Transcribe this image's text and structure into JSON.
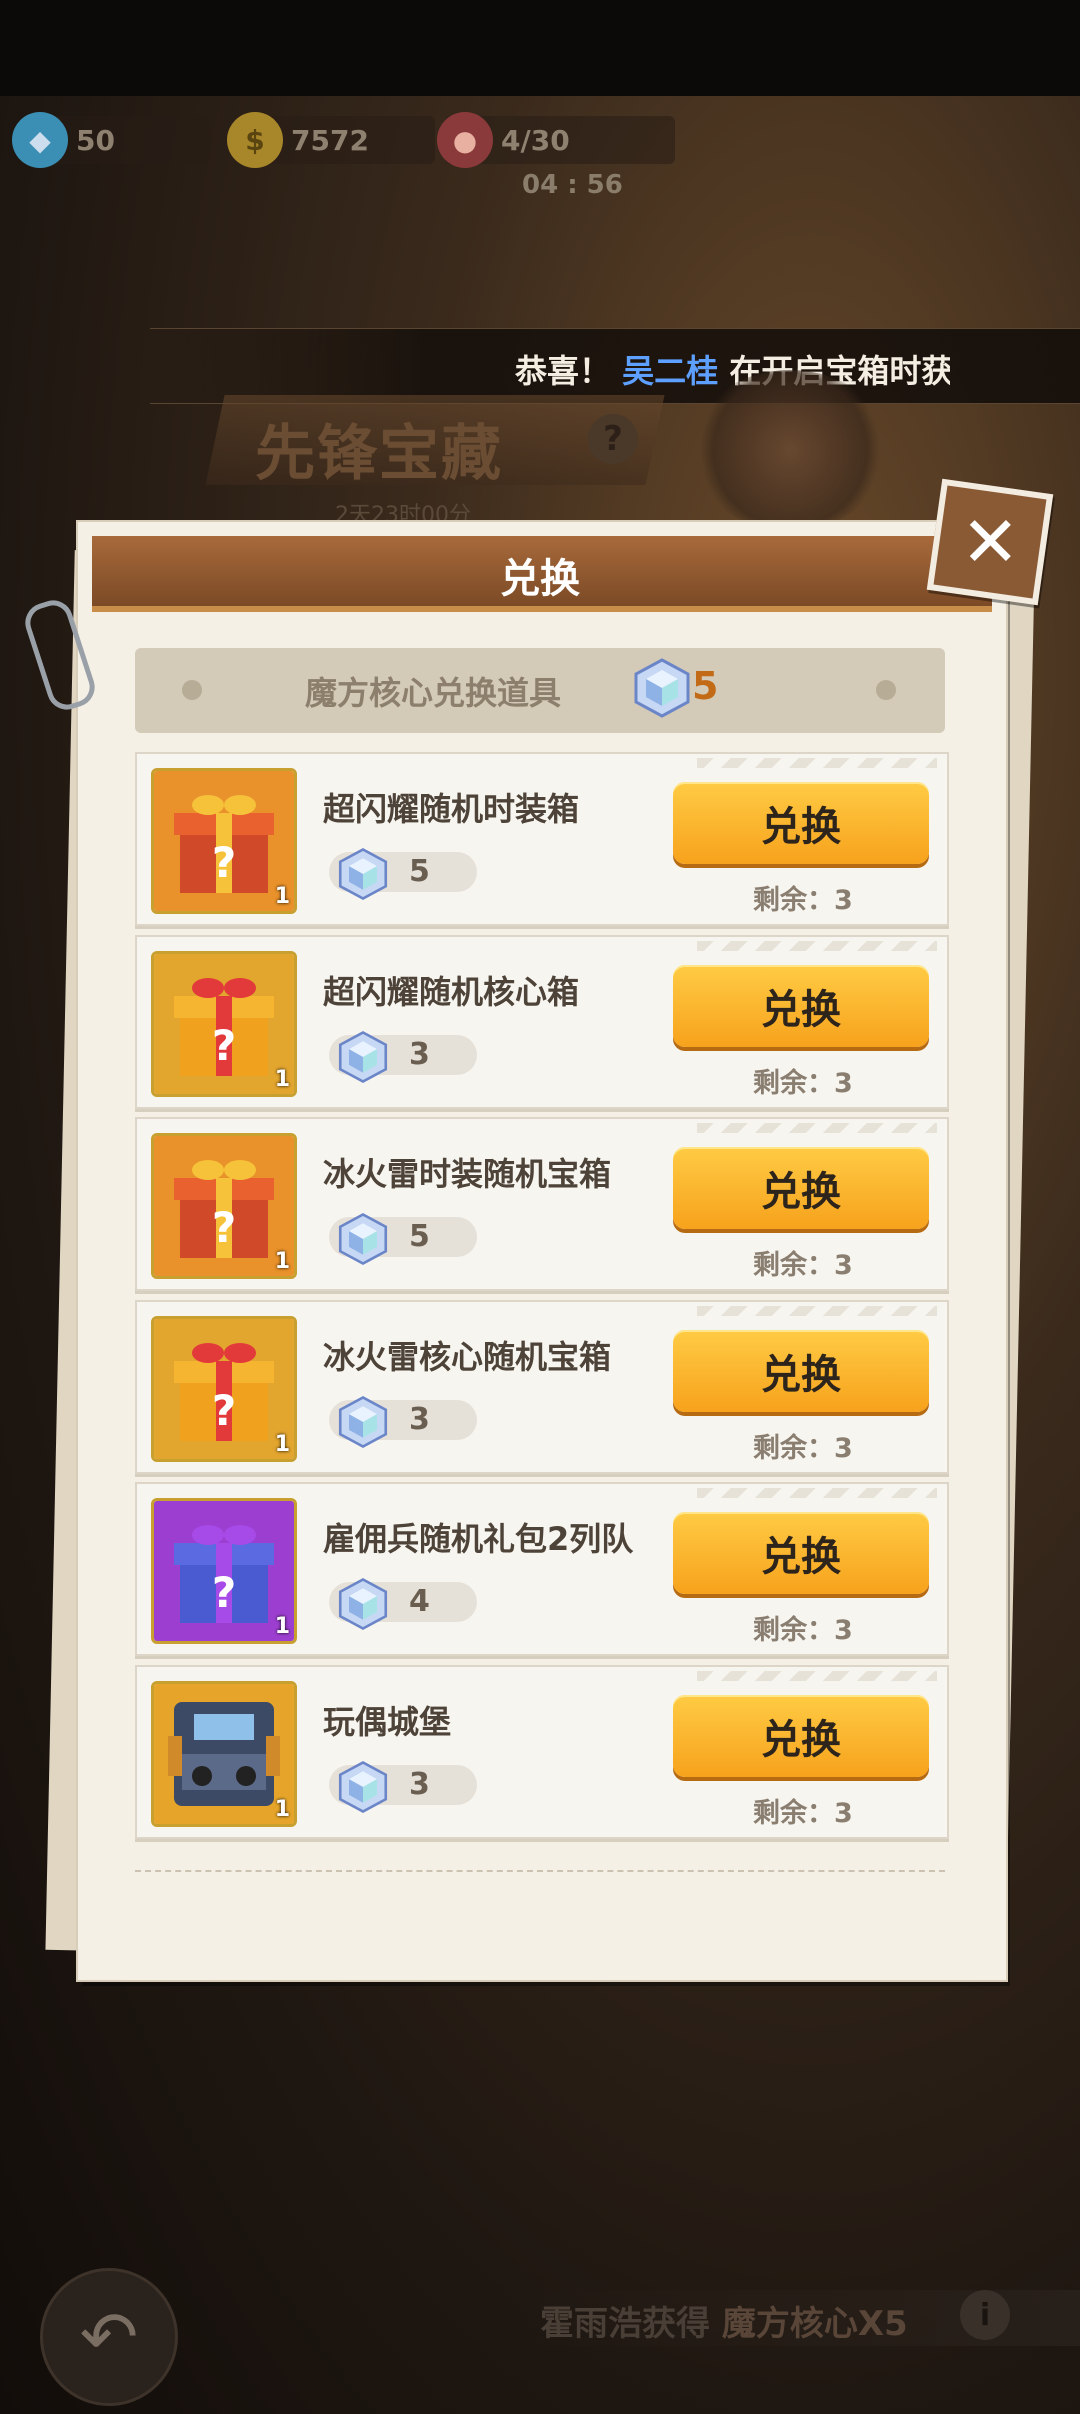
{
  "resources": {
    "gems": "50",
    "coins": "7572",
    "stamina": "4/30",
    "stamina_timer": "04 : 56"
  },
  "ticker": {
    "prefix": "恭喜！",
    "player": "吴二桂",
    "message": "在开启宝箱时获"
  },
  "event": {
    "title": "先锋宝藏",
    "help": "?",
    "countdown": "2天23时00分"
  },
  "dialog": {
    "title": "兑换",
    "close_label": "✕",
    "currency_label": "魔方核心兑换道具",
    "currency_count": "5",
    "items": [
      {
        "name": "超闪耀随机时装箱",
        "cost": "5",
        "qty": "1",
        "button": "兑换",
        "remaining": "剩余：3",
        "icon": "orange-gift-box-icon"
      },
      {
        "name": "超闪耀随机核心箱",
        "cost": "3",
        "qty": "1",
        "button": "兑换",
        "remaining": "剩余：3",
        "icon": "yellow-gift-box-icon"
      },
      {
        "name": "冰火雷时装随机宝箱",
        "cost": "5",
        "qty": "1",
        "button": "兑换",
        "remaining": "剩余：3",
        "icon": "orange-gift-box-icon"
      },
      {
        "name": "冰火雷核心随机宝箱",
        "cost": "3",
        "qty": "1",
        "button": "兑换",
        "remaining": "剩余：3",
        "icon": "yellow-gift-box-icon"
      },
      {
        "name": "雇佣兵随机礼包2列队",
        "cost": "4",
        "qty": "1",
        "button": "兑换",
        "remaining": "剩余：3",
        "icon": "purple-gift-box-icon"
      },
      {
        "name": "玩偶城堡",
        "cost": "3",
        "qty": "1",
        "button": "兑换",
        "remaining": "剩余：3",
        "icon": "toy-castle-icon"
      }
    ]
  },
  "bottom": {
    "player": "霍雨浩获得",
    "reward": "魔方核心X5",
    "info": "i",
    "back": "↶"
  }
}
